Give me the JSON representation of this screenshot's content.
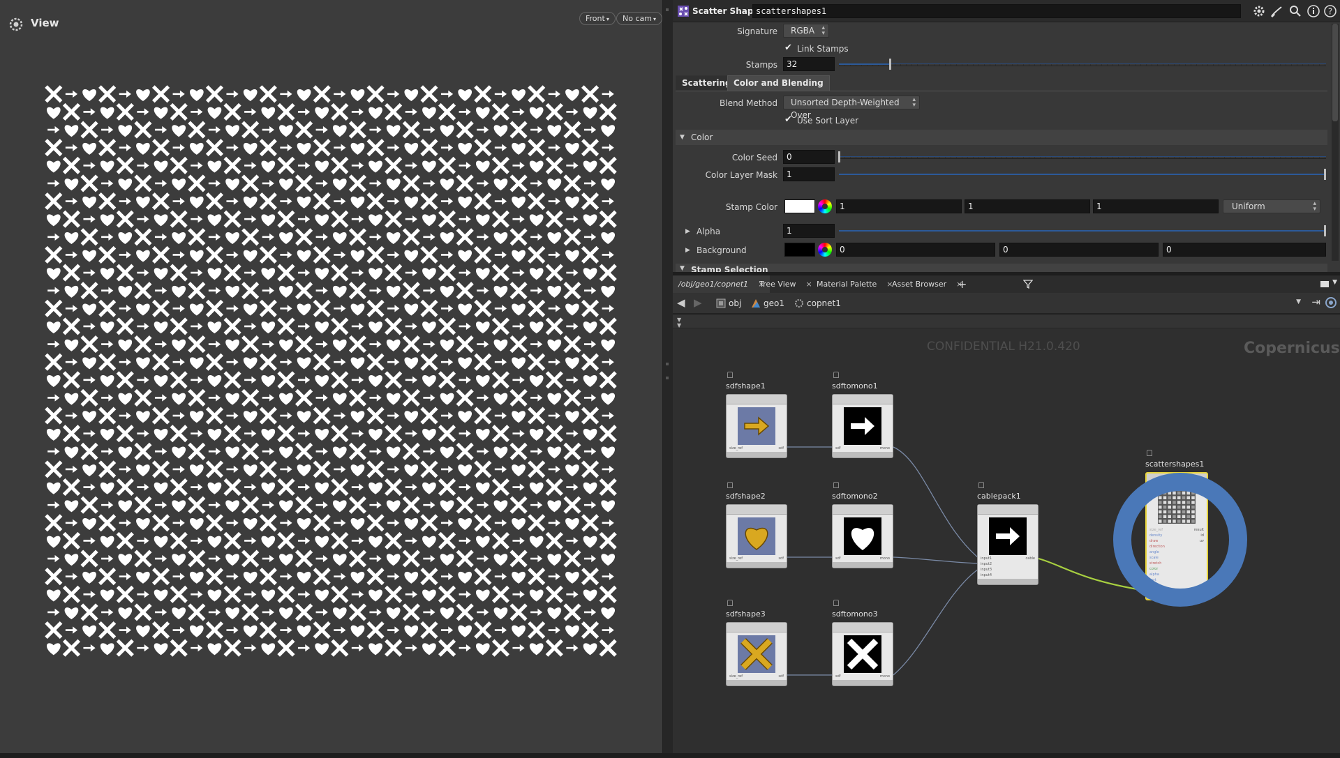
{
  "viewer": {
    "title": "View",
    "camera_view": "Front",
    "camera": "No cam"
  },
  "parameters": {
    "node_type": "Scatter Shapes",
    "node_name": "scattershapes1",
    "signature_label": "Signature",
    "signature_value": "RGBA",
    "link_stamps_label": "Link Stamps",
    "link_stamps_checked": true,
    "stamps_label": "Stamps",
    "stamps_value": "32",
    "tabs": [
      "Scattering",
      "Color and Blending"
    ],
    "active_tab": "Color and Blending",
    "blend_method_label": "Blend Method",
    "blend_method_value": "Unsorted Depth-Weighted Over",
    "use_sort_layer_label": "Use Sort Layer",
    "use_sort_layer_checked": true,
    "color_section": "Color",
    "color_seed_label": "Color Seed",
    "color_seed_value": "0",
    "color_layer_mask_label": "Color Layer Mask",
    "color_layer_mask_value": "1",
    "stamp_color_label": "Stamp Color",
    "stamp_color_r": "1",
    "stamp_color_g": "1",
    "stamp_color_b": "1",
    "stamp_color_mode": "Uniform",
    "alpha_label": "Alpha",
    "alpha_value": "1",
    "background_label": "Background",
    "background_r": "0",
    "background_g": "0",
    "background_b": "0",
    "next_section_partial": "Stamp Selection"
  },
  "network_tabs": [
    {
      "label": "/obj/geo1/copnet1",
      "active": true
    },
    {
      "label": "Tree View",
      "active": false
    },
    {
      "label": "Material Palette",
      "active": false
    },
    {
      "label": "Asset Browser",
      "active": false
    }
  ],
  "breadcrumbs": [
    "obj",
    "geo1",
    "copnet1"
  ],
  "network": {
    "watermark": "CONFIDENTIAL H21.0.420",
    "context_label": "Copernicus",
    "nodes": [
      {
        "name": "sdfshape1",
        "thumb": "arrow-gold"
      },
      {
        "name": "sdftomono1",
        "thumb": "arrow-white"
      },
      {
        "name": "sdfshape2",
        "thumb": "heart-gold"
      },
      {
        "name": "sdftomono2",
        "thumb": "heart-white"
      },
      {
        "name": "sdfshape3",
        "thumb": "x-gold"
      },
      {
        "name": "sdftomono3",
        "thumb": "x-white"
      },
      {
        "name": "cablepack1",
        "thumb": "arrow-white"
      },
      {
        "name": "scattershapes1",
        "thumb": "scatter-grid"
      }
    ],
    "port_labels": {
      "size_ref": "size_ref",
      "sdf": "sdf",
      "mono": "mono",
      "input1": "input1",
      "input2": "input2",
      "input3": "input3",
      "input4": "input4",
      "cable": "cable",
      "scatter_inputs": [
        "size_ref",
        "density",
        "draw",
        "direction",
        "angle",
        "scale",
        "stretch",
        "color",
        "alpha",
        "sort",
        "select",
        "stamps"
      ],
      "scatter_outputs": [
        "result",
        "id",
        "uv"
      ]
    }
  },
  "colors": {
    "accent_blue": "#2c5a9a",
    "selected_ring": "#4a78b8",
    "selected_outline": "#e6d33a",
    "wire_active": "#a8d040"
  }
}
